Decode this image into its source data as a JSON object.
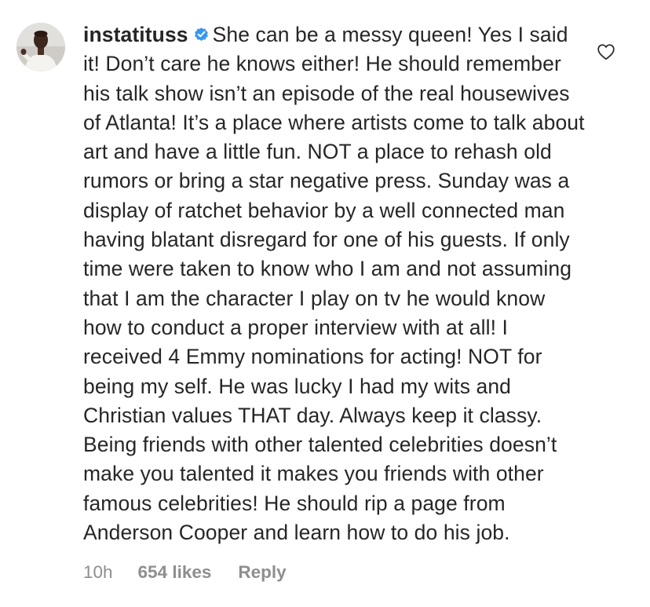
{
  "comment": {
    "username": "instatituss",
    "verified_icon": "verified-badge-icon",
    "text": "She can be a messy queen! Yes I said it! Don’t care he knows either! He should remember his talk show isn’t an episode of the real housewives of Atlanta! It’s a place where artists come to talk about art and have a little fun. NOT a place to rehash old rumors or bring a star negative press. Sunday was a display of ratchet behavior by a well connected man having blatant disregard for one of his guests. If only time were taken to know who I am and not assuming that I am the character I play on tv he would know how to conduct a proper interview with at all! I received 4 Emmy nominations for acting! NOT for being my self. He was lucky I had my wits and Christian values THAT day. Always keep it classy. Being friends with other talented celebrities doesn’t make you talented it makes you friends with other famous celebrities! He should rip a page from Anderson Cooper and learn how to do his job.",
    "time": "10h",
    "likes": "654 likes",
    "reply_label": "Reply",
    "like_icon": "heart-outline-icon",
    "avatar_icon": "profile-avatar"
  },
  "colors": {
    "text": "#262626",
    "meta": "#8e8e8e",
    "verified": "#3897f0",
    "heart": "#262626"
  }
}
